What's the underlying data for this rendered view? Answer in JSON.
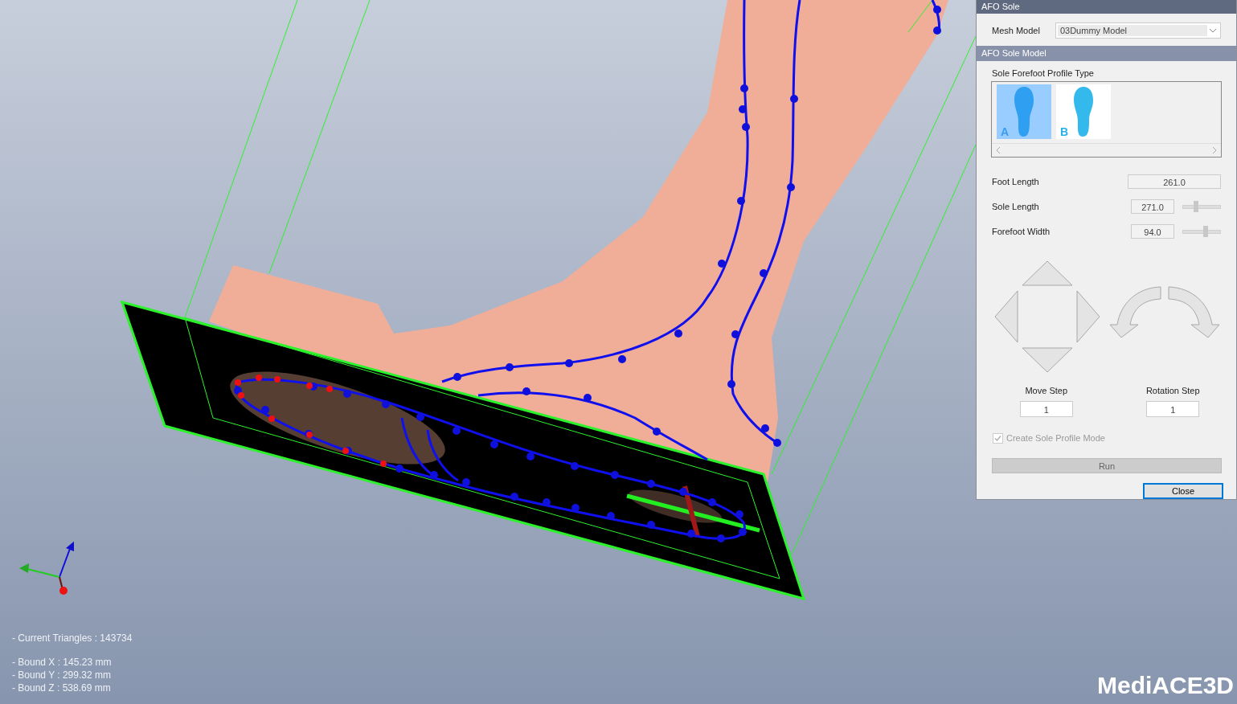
{
  "viewport": {
    "triangles": "- Current Triangles : 143734",
    "bounds": [
      "- Bound X : 145.23 mm",
      "- Bound Y : 299.32 mm",
      "- Bound Z : 538.69 mm"
    ],
    "logo": "MediACE3D"
  },
  "panel": {
    "title": "AFO Sole",
    "mesh_model": {
      "label": "Mesh Model",
      "value": "03Dummy Model"
    },
    "section": "AFO Sole Model",
    "profile_type": {
      "label": "Sole Forefoot Profile Type",
      "options": [
        {
          "label": "A",
          "selected": true
        },
        {
          "label": "B",
          "selected": false
        }
      ]
    },
    "fields": [
      {
        "kind": "plain",
        "label": "Foot Length",
        "value": "261.0"
      },
      {
        "kind": "slider",
        "label": "Sole Length",
        "value": "271.0",
        "level": 0.35
      },
      {
        "kind": "slider",
        "label": "Forefoot Width",
        "value": "94.0",
        "level": 0.6
      }
    ],
    "move_step": {
      "label": "Move Step",
      "value": "1"
    },
    "rotation_step": {
      "label": "Rotation Step",
      "value": "1"
    },
    "create_mode": {
      "label": "Create Sole Profile Mode",
      "checked": true,
      "disabled": true
    },
    "buttons": [
      {
        "label": "Run",
        "disabled": true,
        "focused": false
      },
      {
        "label": "Close",
        "disabled": false,
        "focused": true
      }
    ]
  }
}
